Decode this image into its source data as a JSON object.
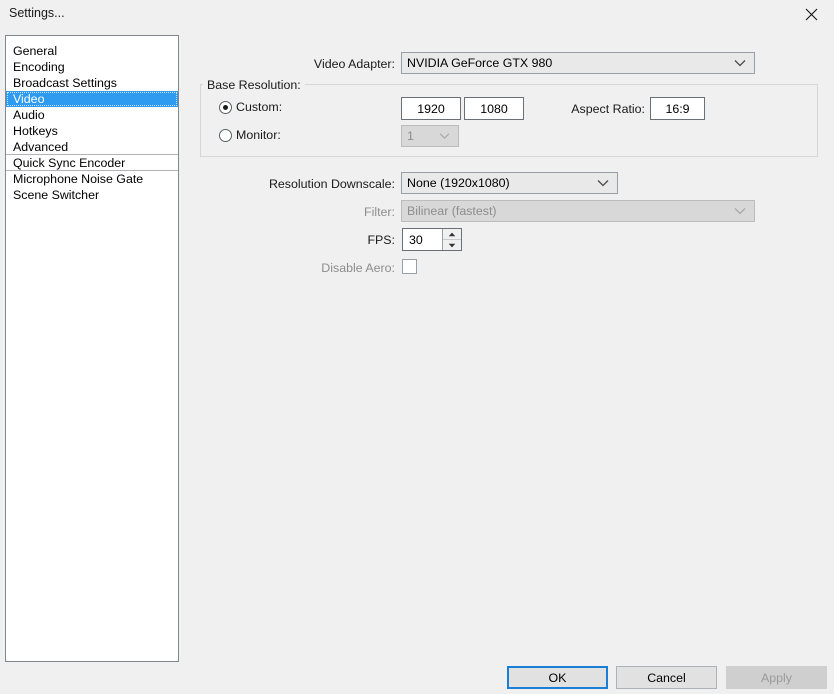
{
  "window": {
    "title": "Settings...",
    "close_icon": "close-icon"
  },
  "sidebar": {
    "items": [
      {
        "label": "General",
        "selected": false
      },
      {
        "label": "Encoding",
        "selected": false
      },
      {
        "label": "Broadcast Settings",
        "selected": false
      },
      {
        "label": "Video",
        "selected": true
      },
      {
        "label": "Audio",
        "selected": false
      },
      {
        "label": "Hotkeys",
        "selected": false
      },
      {
        "label": "Advanced",
        "selected": false
      },
      {
        "label": "Quick Sync Encoder",
        "selected": false
      },
      {
        "label": "Microphone Noise Gate",
        "selected": false
      },
      {
        "label": "Scene Switcher",
        "selected": false
      }
    ]
  },
  "main": {
    "video_adapter": {
      "label": "Video Adapter:",
      "value": "NVIDIA GeForce GTX 980",
      "enabled": true
    },
    "base_resolution": {
      "group_label": "Base Resolution:",
      "custom": {
        "label": "Custom:",
        "selected": true,
        "width": "1920",
        "height": "1080"
      },
      "monitor": {
        "label": "Monitor:",
        "selected": false,
        "value": "1",
        "enabled": false
      },
      "aspect_ratio": {
        "label": "Aspect Ratio:",
        "value": "16:9"
      }
    },
    "resolution_downscale": {
      "label": "Resolution Downscale:",
      "value": "None  (1920x1080)",
      "enabled": true
    },
    "filter": {
      "label": "Filter:",
      "value": "Bilinear (fastest)",
      "enabled": false
    },
    "fps": {
      "label": "FPS:",
      "value": "30"
    },
    "disable_aero": {
      "label": "Disable Aero:",
      "checked": false,
      "enabled": false
    }
  },
  "footer": {
    "ok": "OK",
    "cancel": "Cancel",
    "apply": "Apply",
    "apply_enabled": false
  },
  "colors": {
    "dialog_bg": "#f0f0f0",
    "selection_blue": "#2f9bf0",
    "default_button_border": "#1a7fd4"
  }
}
